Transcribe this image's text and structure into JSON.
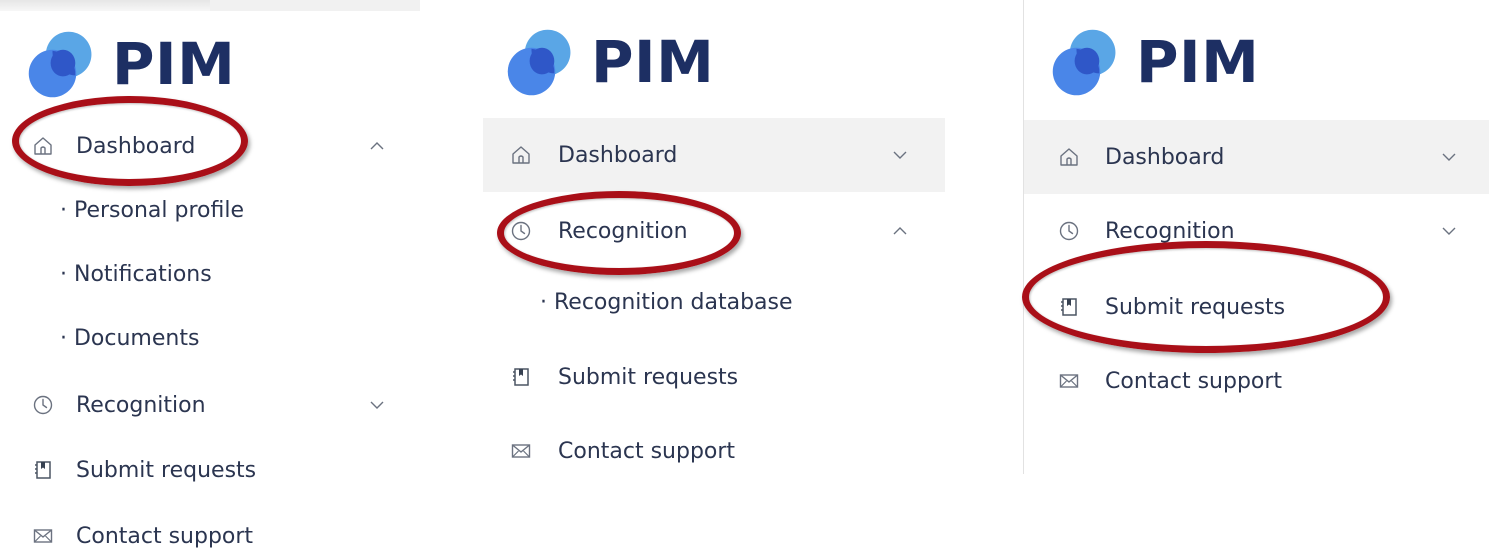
{
  "brand": {
    "name": "PIM",
    "logo_dark": "#2f57c8",
    "logo_light": "#5aa6e6",
    "text_color": "#1d2f63"
  },
  "accent": {
    "annotation_ring": "#a90f18"
  },
  "panels": [
    {
      "menu": [
        {
          "label": "Dashboard",
          "icon": "home-icon",
          "chevron": "up"
        },
        {
          "label": "Recognition",
          "icon": "clock-icon",
          "chevron": "down"
        },
        {
          "label": "Submit requests",
          "icon": "bookmark-icon"
        },
        {
          "label": "Contact support",
          "icon": "mail-icon"
        }
      ],
      "submenu": [
        "· Personal profile",
        "· Notifications",
        "· Documents"
      ]
    },
    {
      "menu": [
        {
          "label": "Dashboard",
          "icon": "home-icon",
          "chevron": "down"
        },
        {
          "label": "Recognition",
          "icon": "clock-icon",
          "chevron": "up"
        },
        {
          "label": "Submit requests",
          "icon": "bookmark-icon"
        },
        {
          "label": "Contact support",
          "icon": "mail-icon"
        }
      ],
      "submenu": [
        "· Recognition database"
      ]
    },
    {
      "menu": [
        {
          "label": "Dashboard",
          "icon": "home-icon",
          "chevron": "down"
        },
        {
          "label": "Recognition",
          "icon": "clock-icon",
          "chevron": "down"
        },
        {
          "label": "Submit requests",
          "icon": "bookmark-icon"
        },
        {
          "label": "Contact support",
          "icon": "mail-icon"
        }
      ]
    }
  ]
}
